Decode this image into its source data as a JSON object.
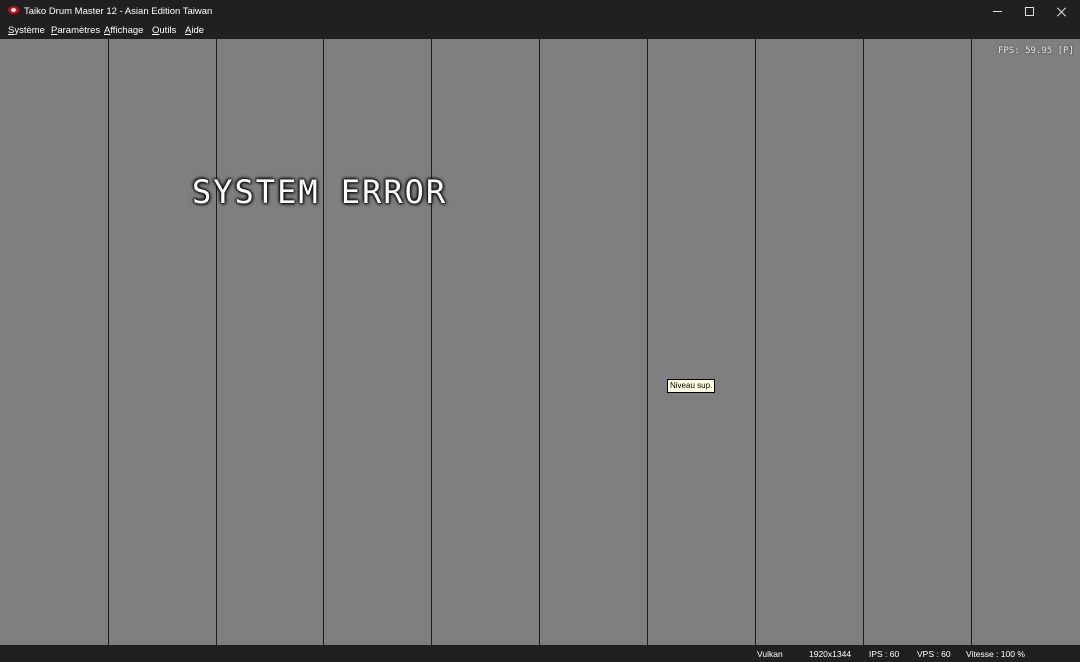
{
  "window": {
    "title": "Taiko Drum Master 12 - Asian Edition Taiwan"
  },
  "menu": [
    {
      "key": "S",
      "rest": "ystème"
    },
    {
      "key": "P",
      "rest": "aramètres"
    },
    {
      "key": "A",
      "rest": "ffichage"
    },
    {
      "key": "O",
      "rest": "utils"
    },
    {
      "key": "A",
      "rest": "ide"
    }
  ],
  "game": {
    "fps": "FPS: 59.95 [P]",
    "error_title": "SYSTEM ERROR",
    "tooltip": "Niveau sup."
  },
  "status": {
    "renderer": "Vulkan",
    "resolution": "1920x1344",
    "ips": "IPS : 60",
    "vps": "VPS : 60",
    "speed": "Vitesse : 100 %"
  },
  "colors": {
    "titlebar_bg": "#202020",
    "game_bg": "#7f7f7f",
    "divider": "#1e1e1e",
    "tooltip_bg": "#ffffe1"
  },
  "icons": [
    "app-icon",
    "minimize-icon",
    "maximize-icon",
    "close-icon"
  ]
}
